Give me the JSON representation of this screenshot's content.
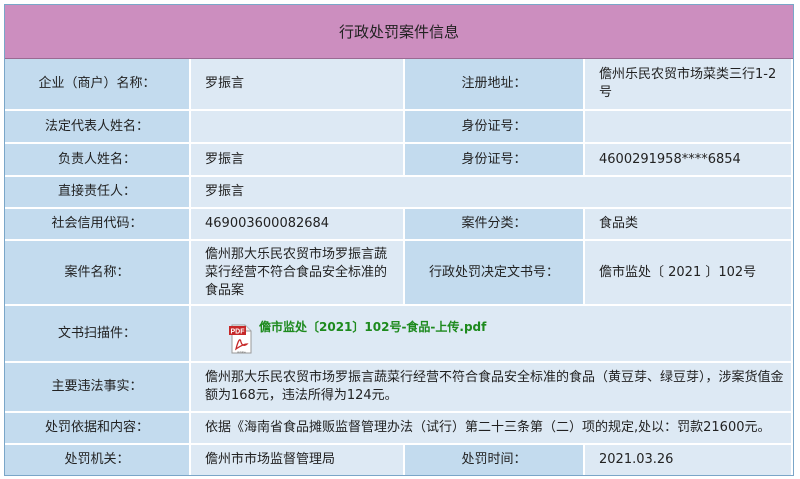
{
  "title": "行政处罚案件信息",
  "rows": {
    "company": {
      "label": "企业（商户）名称：",
      "value": "罗振言",
      "label2": "注册地址：",
      "value2": "儋州乐民农贸市场菜类三行1-2号"
    },
    "legal_rep": {
      "label": "法定代表人姓名：",
      "value": "",
      "label2": "身份证号：",
      "value2": ""
    },
    "person_in_charge": {
      "label": "负责人姓名：",
      "value": "罗振言",
      "label2": "身份证号：",
      "value2": "4600291958****6854"
    },
    "direct_responsible": {
      "label": "直接责任人：",
      "value": "罗振言"
    },
    "credit_code": {
      "label": "社会信用代码：",
      "value": "469003600082684",
      "label2": "案件分类：",
      "value2": "食品类"
    },
    "case_name": {
      "label": "案件名称：",
      "value": "儋州那大乐民农贸市场罗振言蔬菜行经营不符合食品安全标准的食品案",
      "label2": "行政处罚决定文书号：",
      "value2": "儋市监处〔 2021 〕102号"
    },
    "scan": {
      "label": "文书扫描件：",
      "file": "儋市监处〔2021〕102号-食品-上传.pdf",
      "icon_text": "PDF",
      "icon_sub": "Adobe"
    },
    "violation": {
      "label": "主要违法事实：",
      "value": "儋州那大乐民农贸市场罗振言蔬菜行经营不符合食品安全标准的食品（黄豆芽、绿豆芽），涉案货值金额为168元，违法所得为124元。"
    },
    "basis": {
      "label": "处罚依据和内容：",
      "value": "依据《海南省食品摊贩监督管理办法（试行）第二十三条第（二）项的规定,处以：罚款21600元。"
    },
    "authority": {
      "label": "处罚机关：",
      "value": "儋州市市场监督管理局",
      "label2": "处罚时间：",
      "value2": "2021.03.26"
    }
  }
}
